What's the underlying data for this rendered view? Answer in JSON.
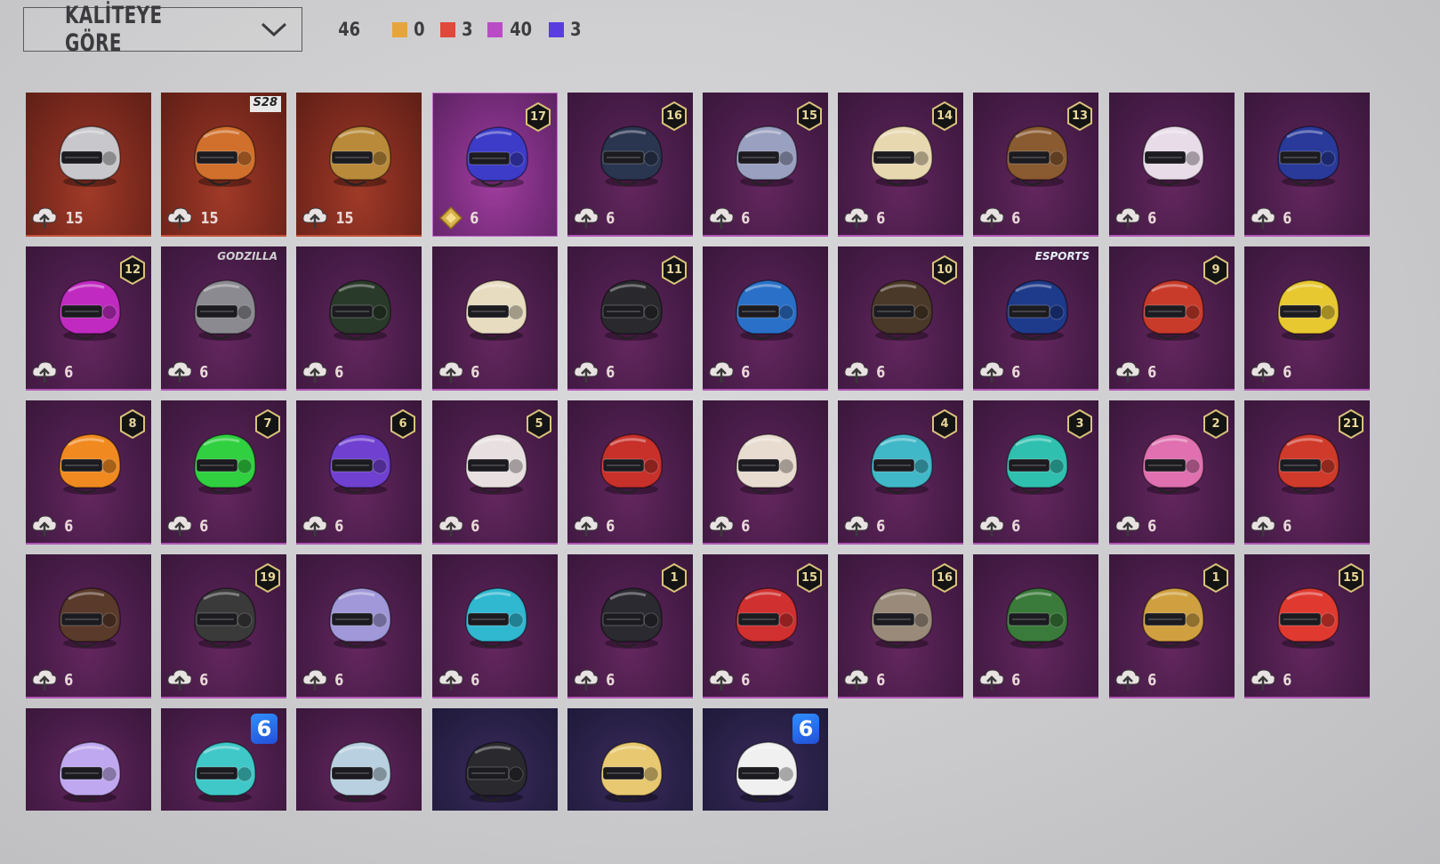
{
  "toolbar": {
    "sort_label": "KALİTEYE GÖRE",
    "total": "46",
    "counts": [
      {
        "color": "#e6a53b",
        "value": "0"
      },
      {
        "color": "#e0483b",
        "value": "3"
      },
      {
        "color": "#b94cc6",
        "value": "40"
      },
      {
        "color": "#5a3de0",
        "value": "3"
      }
    ]
  },
  "colors": {
    "gold": "#e6a53b",
    "red": "#e0483b",
    "purple": "#b94cc6",
    "blue": "#5a3de0"
  },
  "items": [
    {
      "rarity": "red",
      "cost": "15",
      "badge": "",
      "tag": "",
      "helmet": "#c8c8cc"
    },
    {
      "rarity": "red",
      "cost": "15",
      "badge": "",
      "tag": "S28",
      "helmet": "#d0702c"
    },
    {
      "rarity": "red",
      "cost": "15",
      "badge": "",
      "tag": "",
      "helmet": "#b98a3a"
    },
    {
      "rarity": "purple-hi",
      "cost": "6",
      "badge": "17",
      "tag": "",
      "helmet": "#3c3cc8",
      "icon": "gem"
    },
    {
      "rarity": "purple",
      "cost": "6",
      "badge": "16",
      "tag": "",
      "helmet": "#2a3550"
    },
    {
      "rarity": "purple",
      "cost": "6",
      "badge": "15",
      "tag": "",
      "helmet": "#9aa0c0"
    },
    {
      "rarity": "purple",
      "cost": "6",
      "badge": "14",
      "tag": "",
      "helmet": "#e8d8b0"
    },
    {
      "rarity": "purple",
      "cost": "6",
      "badge": "13",
      "tag": "",
      "helmet": "#8a5a30"
    },
    {
      "rarity": "purple",
      "cost": "6",
      "badge": "",
      "tag": "",
      "helmet": "#e8dce8"
    },
    {
      "rarity": "purple",
      "cost": "6",
      "badge": "",
      "tag": "",
      "helmet": "#2a3a9a"
    },
    {
      "rarity": "purple",
      "cost": "6",
      "badge": "12",
      "tag": "",
      "helmet": "#c02ac0"
    },
    {
      "rarity": "purple",
      "cost": "6",
      "badge": "",
      "tag": "GODZILLA",
      "helmet": "#8a8a90"
    },
    {
      "rarity": "purple",
      "cost": "6",
      "badge": "",
      "tag": "",
      "helmet": "#2a3a2a"
    },
    {
      "rarity": "purple",
      "cost": "6",
      "badge": "",
      "tag": "",
      "helmet": "#e8dcc0"
    },
    {
      "rarity": "purple",
      "cost": "6",
      "badge": "11",
      "tag": "",
      "helmet": "#2a2a2e"
    },
    {
      "rarity": "purple",
      "cost": "6",
      "badge": "",
      "tag": "",
      "helmet": "#2a70c8"
    },
    {
      "rarity": "purple",
      "cost": "6",
      "badge": "10",
      "tag": "",
      "helmet": "#4a3828"
    },
    {
      "rarity": "purple",
      "cost": "6",
      "badge": "",
      "tag": "ESPORTS",
      "helmet": "#1e3a8a"
    },
    {
      "rarity": "purple",
      "cost": "6",
      "badge": "9",
      "tag": "",
      "helmet": "#c83a2a"
    },
    {
      "rarity": "purple",
      "cost": "6",
      "badge": "",
      "tag": "",
      "helmet": "#e8c830"
    },
    {
      "rarity": "purple",
      "cost": "6",
      "badge": "8",
      "tag": "",
      "helmet": "#f08a20"
    },
    {
      "rarity": "purple",
      "cost": "6",
      "badge": "7",
      "tag": "",
      "helmet": "#30d040"
    },
    {
      "rarity": "purple",
      "cost": "6",
      "badge": "6",
      "tag": "",
      "helmet": "#7040d0"
    },
    {
      "rarity": "purple",
      "cost": "6",
      "badge": "5",
      "tag": "",
      "helmet": "#e8e0e0"
    },
    {
      "rarity": "purple",
      "cost": "6",
      "badge": "",
      "tag": "",
      "helmet": "#c8302a"
    },
    {
      "rarity": "purple",
      "cost": "6",
      "badge": "",
      "tag": "",
      "helmet": "#e8dcd0"
    },
    {
      "rarity": "purple",
      "cost": "6",
      "badge": "4",
      "tag": "",
      "helmet": "#40b8c8"
    },
    {
      "rarity": "purple",
      "cost": "6",
      "badge": "3",
      "tag": "",
      "helmet": "#30c0b0"
    },
    {
      "rarity": "purple",
      "cost": "6",
      "badge": "2",
      "tag": "",
      "helmet": "#e070b0"
    },
    {
      "rarity": "purple",
      "cost": "6",
      "badge": "21",
      "tag": "",
      "helmet": "#d03a2a"
    },
    {
      "rarity": "purple",
      "cost": "6",
      "badge": "",
      "tag": "",
      "helmet": "#5a3a2a"
    },
    {
      "rarity": "purple",
      "cost": "6",
      "badge": "19",
      "tag": "",
      "helmet": "#3a3a3a"
    },
    {
      "rarity": "purple",
      "cost": "6",
      "badge": "",
      "tag": "",
      "helmet": "#a098d8"
    },
    {
      "rarity": "purple",
      "cost": "6",
      "badge": "",
      "tag": "",
      "helmet": "#30b8d0"
    },
    {
      "rarity": "purple",
      "cost": "6",
      "badge": "1",
      "tag": "",
      "helmet": "#2a2a30"
    },
    {
      "rarity": "purple",
      "cost": "6",
      "badge": "15",
      "tag": "",
      "helmet": "#d03030"
    },
    {
      "rarity": "purple",
      "cost": "6",
      "badge": "16",
      "tag": "",
      "helmet": "#9a8a7a"
    },
    {
      "rarity": "purple",
      "cost": "6",
      "badge": "",
      "tag": "",
      "helmet": "#3a7a3a"
    },
    {
      "rarity": "purple",
      "cost": "6",
      "badge": "1",
      "tag": "",
      "helmet": "#d0a040"
    },
    {
      "rarity": "purple",
      "cost": "6",
      "badge": "15",
      "tag": "",
      "helmet": "#e03a30"
    },
    {
      "rarity": "purple",
      "cost": "",
      "badge": "",
      "tag": "",
      "helmet": "#c0a8f0"
    },
    {
      "rarity": "purple",
      "cost": "",
      "badge": "6",
      "tag": "",
      "helmet": "#40c8c8"
    },
    {
      "rarity": "purple",
      "cost": "",
      "badge": "",
      "tag": "",
      "helmet": "#b8d0e0"
    },
    {
      "rarity": "blue",
      "cost": "",
      "badge": "",
      "tag": "",
      "helmet": "#2a2a2e"
    },
    {
      "rarity": "blue",
      "cost": "",
      "badge": "",
      "tag": "",
      "helmet": "#e8c870"
    },
    {
      "rarity": "blue",
      "cost": "",
      "badge": "6",
      "tag": "",
      "helmet": "#f0f0f0"
    }
  ]
}
